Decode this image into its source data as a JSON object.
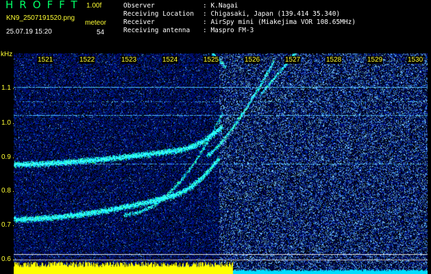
{
  "app": {
    "title": "HROFFT",
    "version": "1.00f",
    "filename": "KN9_2507191520.png",
    "timestamp": "25.07.19 15:20",
    "meteor_label": "meteor",
    "meteor_count": "54"
  },
  "info": [
    {
      "key": "Observer",
      "value": ": K.Nagai"
    },
    {
      "key": "Receiving Location",
      "value": ": Chigasaki, Japan (139.414 35.340)"
    },
    {
      "key": "Receiver",
      "value": ": AirSpy mini (Miakejima VOR 108.65MHz)"
    },
    {
      "key": "Receiving antenna",
      "value": ": Maspro FM-3"
    }
  ],
  "axes": {
    "y_unit": "kHz",
    "y_ticks": [
      "1.1",
      "1.0",
      "0.9",
      "0.8",
      "0.7",
      "0.6"
    ],
    "x_ticks": [
      "1521",
      "1522",
      "1523",
      "1524",
      "1525",
      "1526",
      "1527",
      "1528",
      "1529",
      "1530"
    ]
  },
  "colors": {
    "text_green": "#00ff66",
    "text_yellow": "#ffff33",
    "background": "#000000",
    "noise_floor": "#0a1a8c",
    "signal": "#00ff99"
  }
}
